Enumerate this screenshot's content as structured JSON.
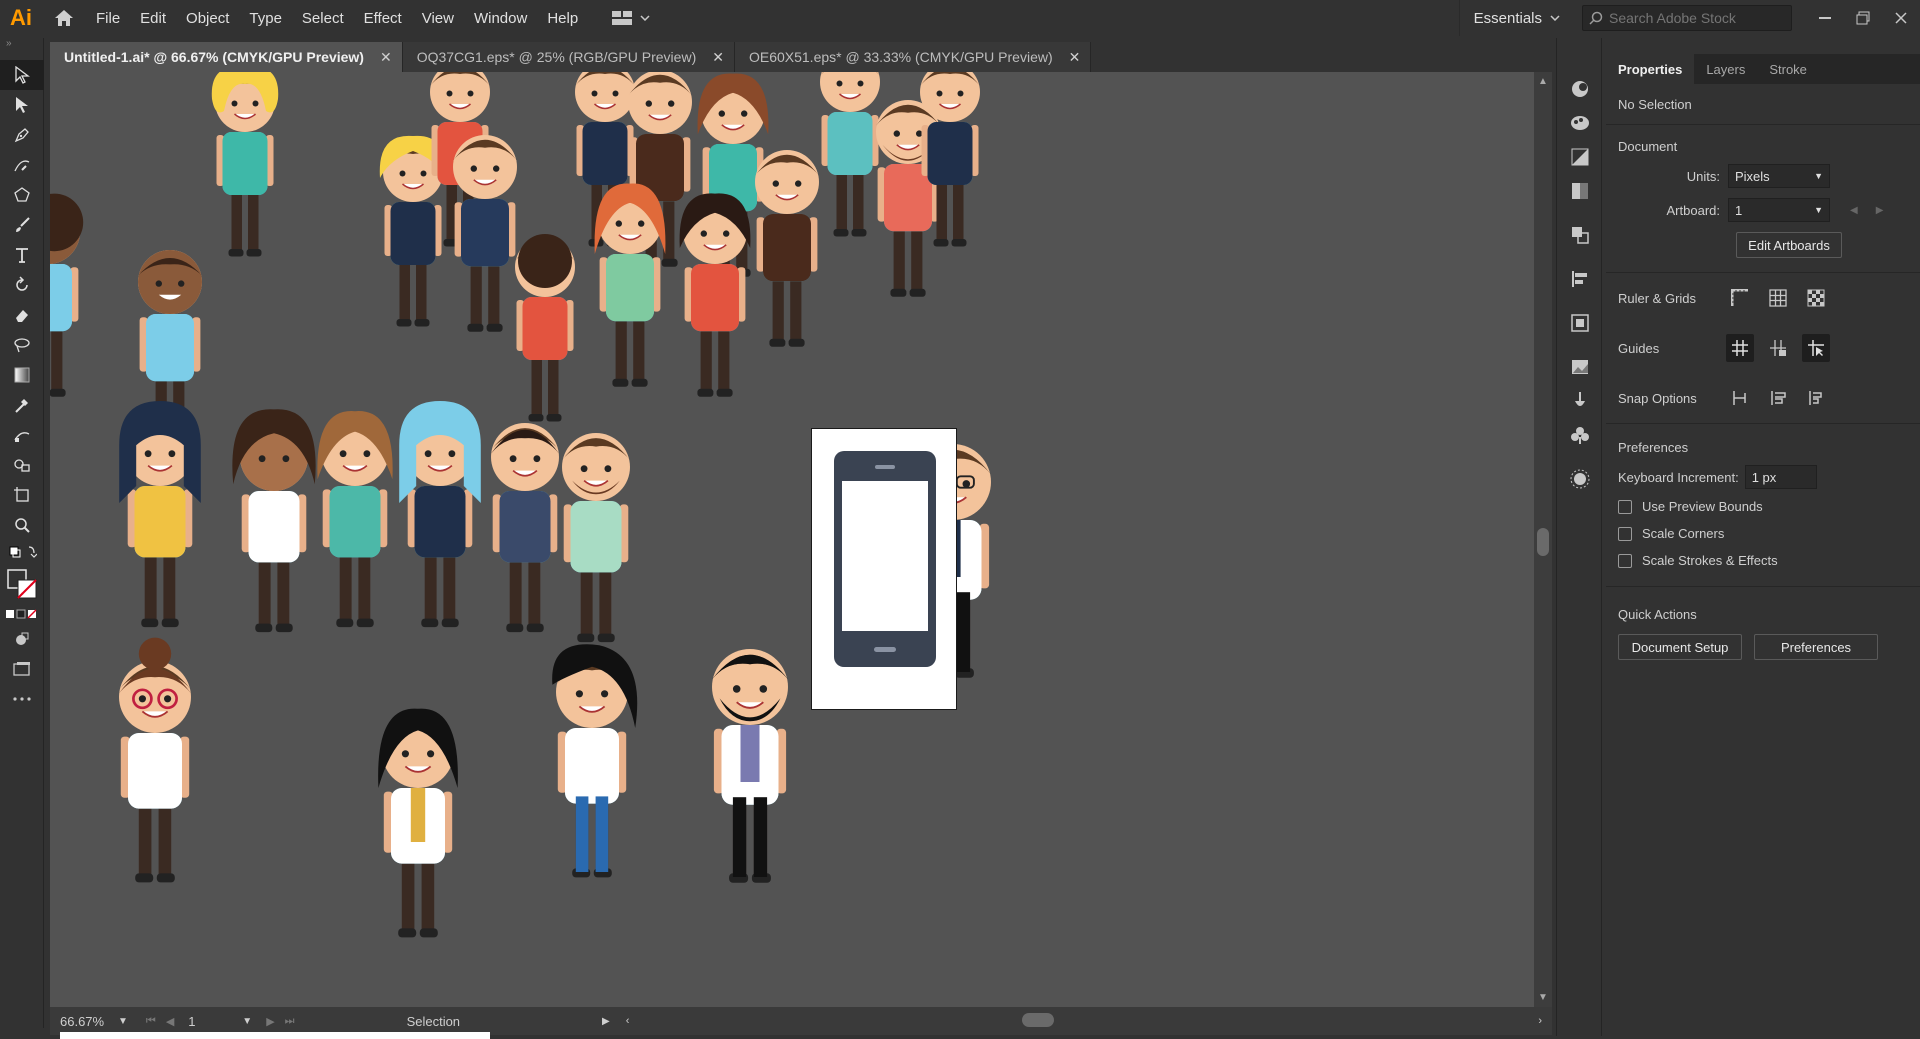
{
  "app": {
    "logo": "Ai"
  },
  "menu": [
    "File",
    "Edit",
    "Object",
    "Type",
    "Select",
    "Effect",
    "View",
    "Window",
    "Help"
  ],
  "workspace": {
    "label": "Essentials"
  },
  "stock_search": {
    "placeholder": "Search Adobe Stock"
  },
  "tabs": [
    {
      "label": "Untitled-1.ai* @ 66.67% (CMYK/GPU Preview)",
      "active": true
    },
    {
      "label": "OQ37CG1.eps* @ 25% (RGB/GPU Preview)",
      "active": false
    },
    {
      "label": "OE60X51.eps* @ 33.33% (CMYK/GPU Preview)",
      "active": false
    }
  ],
  "status": {
    "zoom": "66.67%",
    "artboard": "1",
    "tool": "Selection"
  },
  "properties": {
    "tabs": [
      "Properties",
      "Layers",
      "Stroke"
    ],
    "selection": "No Selection",
    "document": {
      "heading": "Document",
      "units_label": "Units:",
      "units_value": "Pixels",
      "artboard_label": "Artboard:",
      "artboard_value": "1",
      "edit_artboards": "Edit Artboards"
    },
    "ruler_grids": "Ruler & Grids",
    "guides": "Guides",
    "snap_options": "Snap Options",
    "preferences": {
      "heading": "Preferences",
      "keyboard_label": "Keyboard Increment:",
      "keyboard_value": "1 px",
      "use_preview_bounds": "Use Preview Bounds",
      "scale_corners": "Scale Corners",
      "scale_strokes": "Scale Strokes & Effects"
    },
    "quick_actions": {
      "heading": "Quick Actions",
      "document_setup": "Document Setup",
      "preferences": "Preferences"
    }
  },
  "colors": {
    "accent": "#ff9a00",
    "canvas": "#535353",
    "chrome": "#323232"
  }
}
